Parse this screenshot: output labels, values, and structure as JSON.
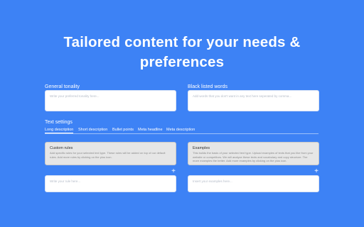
{
  "header": {
    "title_line1": "Tailored content for your needs &",
    "title_line2": "preferences"
  },
  "general_tonality": {
    "label": "General tonality",
    "placeholder": "Write your preferred tonality here..."
  },
  "black_listed_words": {
    "label": "Black listed words",
    "placeholder": "Add words that you don't want in any text here seperated by comma..."
  },
  "text_settings": {
    "label": "Text settings",
    "tabs": [
      {
        "label": "Long description",
        "active": true
      },
      {
        "label": "Short description",
        "active": false
      },
      {
        "label": "Bullet points",
        "active": false
      },
      {
        "label": "Meta headline",
        "active": false
      },
      {
        "label": "Meta description",
        "active": false
      }
    ]
  },
  "custom_rules": {
    "title": "Custom rules",
    "description": "Add specific rules for your selected text type. These rules will be added on top of our default rules. Add more rules by clicking on the plus icon.",
    "input_placeholder": "Write your rule here...",
    "add_icon": "+"
  },
  "examples": {
    "title": "Examples",
    "description": "This builds the basis of your selected text type. Upload examples of texts that you like from your website or competitors. We will analyze these texts and vocabulary and copy structure. The more examples the better. Add more examples by clicking on the plus icon.",
    "input_placeholder": "Insert your examples here...",
    "add_icon": "+"
  },
  "colors": {
    "background": "#3d82f5",
    "card": "#e6e6e6",
    "input": "#ffffff"
  }
}
